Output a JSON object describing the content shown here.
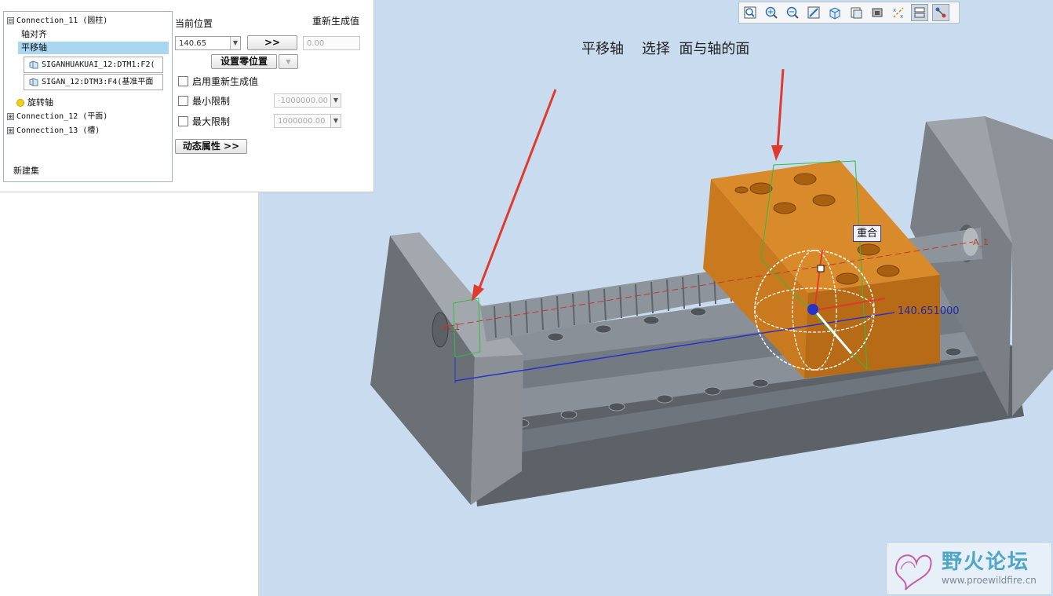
{
  "tree": {
    "items": [
      {
        "label": "Connection_11 (圆柱)",
        "expander": "⊟"
      },
      {
        "label": "轴对齐"
      },
      {
        "label": "平移轴"
      },
      {
        "ref": "SIGANHUAKUAI_12:DTM1:F2("
      },
      {
        "ref": "SIGAN_12:DTM3:F4(基准平面"
      },
      {
        "label": "旋转轴"
      },
      {
        "label": "Connection_12 (平面)",
        "expander": "⊞"
      },
      {
        "label": "Connection_13 (槽)",
        "expander": "⊞"
      },
      {
        "label": "新建集"
      }
    ]
  },
  "props": {
    "current_position_label": "当前位置",
    "regen_value_label": "重新生成值",
    "current_position_value": "140.65",
    "copy_button": ">>",
    "regen_value": "0.00",
    "set_zero_button": "设置零位置",
    "enable_regen_label": "启用重新生成值",
    "min_limit_label": "最小限制",
    "min_limit_value": "-1000000.00",
    "max_limit_label": "最大限制",
    "max_limit_value": "1000000.00",
    "dynamic_props_button": "动态属性 >>"
  },
  "toolbar": {
    "icons": [
      "zoom-window-icon",
      "zoom-in-icon",
      "zoom-out-icon",
      "refit-icon",
      "view-orientation-icon",
      "saved-views-icon",
      "display-style-icon",
      "datum-display-icon",
      "selection-filter-icon",
      "connection-display-icon"
    ]
  },
  "viewport": {
    "annotation": "平移轴    选择  面与轴的面",
    "coincident_tag": "重合",
    "dimension_value": "140.651000",
    "axis_label_left": "A_1",
    "axis_label_right": "A_1"
  },
  "watermark": {
    "title": "野火论坛",
    "url": "www.proewildfire.cn"
  },
  "colors": {
    "viewport_bg": "#c9dcef",
    "selection_bg": "#a9d7f2",
    "block_orange": "#d6892a",
    "arrow_red": "#e03a2f",
    "dimension_blue": "#1e2ba8",
    "watermark_teal": "#4da6c8"
  }
}
